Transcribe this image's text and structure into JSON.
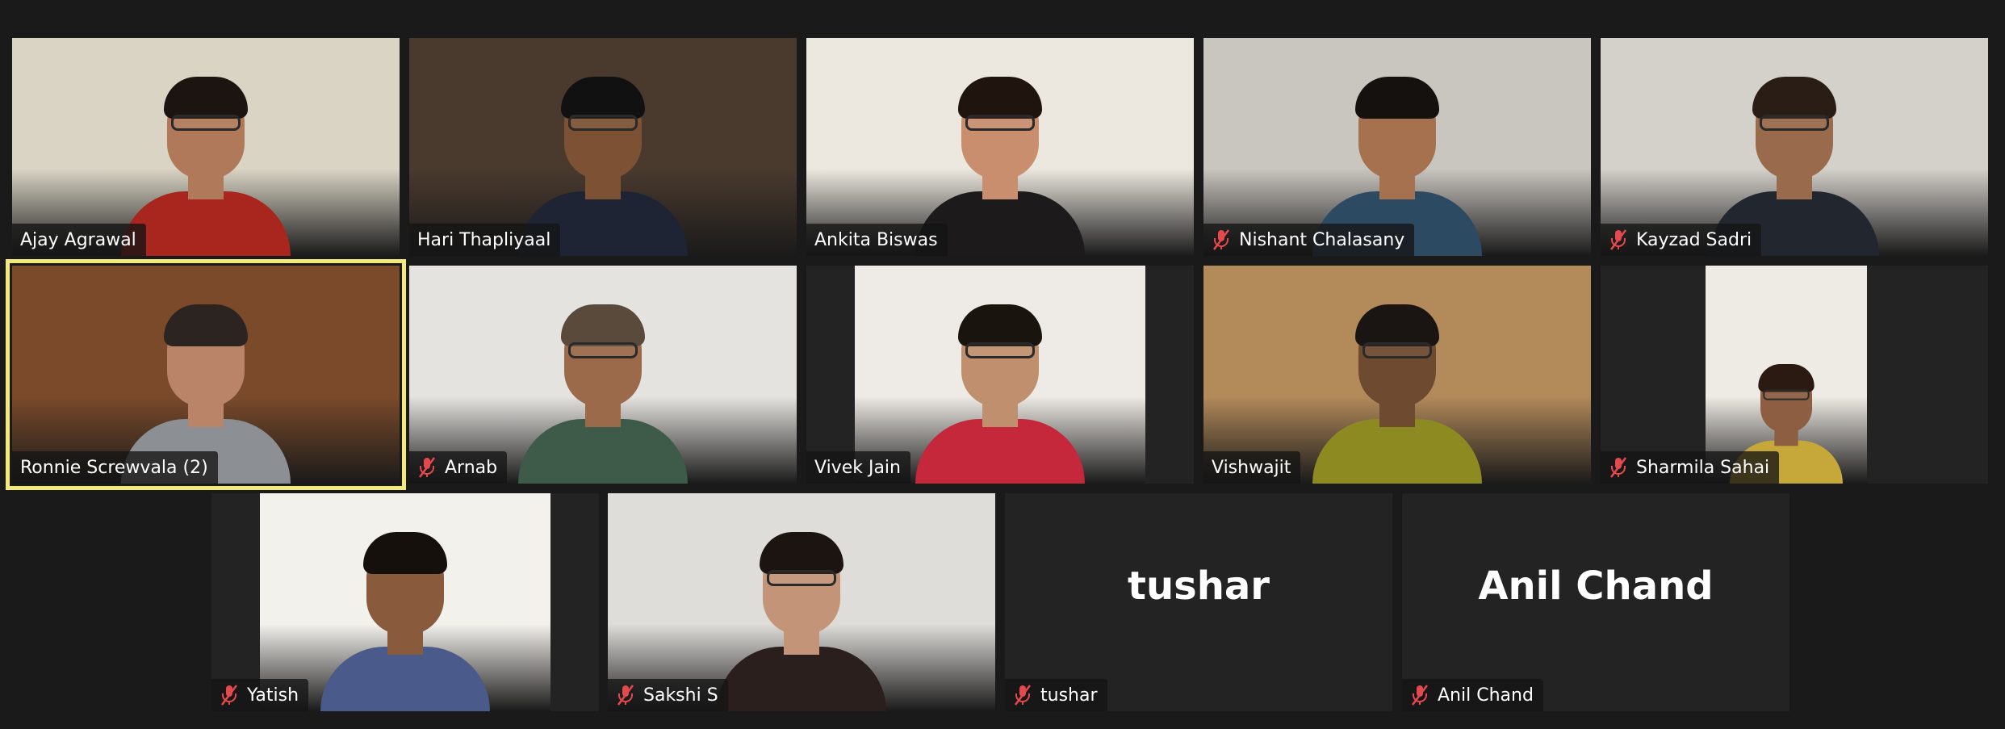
{
  "meeting": {
    "active_speaker": "Ronnie Screwvala (2)",
    "participants": [
      {
        "name": "Ajay Agrawal",
        "muted": false,
        "video": true,
        "bg": "#d9d4c4",
        "shirt": "#a8261e",
        "skin": "#b07a5a",
        "hair": "#1b1410",
        "glasses": true
      },
      {
        "name": "Hari Thapliyaal",
        "muted": false,
        "video": true,
        "bg": "#4a3a2e",
        "shirt": "#1e2433",
        "skin": "#7d5234",
        "hair": "#111111",
        "glasses": true
      },
      {
        "name": "Ankita Biswas",
        "muted": false,
        "video": true,
        "bg": "#ece8df",
        "shirt": "#1c1a1a",
        "skin": "#c98e6e",
        "hair": "#20140e",
        "glasses": true
      },
      {
        "name": "Nishant Chalasany",
        "muted": true,
        "video": true,
        "bg": "#c9c5bf",
        "shirt": "#2d4a63",
        "skin": "#a5714f",
        "hair": "#15110e",
        "glasses": false
      },
      {
        "name": "Kayzad Sadri",
        "muted": true,
        "video": true,
        "bg": "#d4d0ca",
        "shirt": "#22262e",
        "skin": "#9a6a4c",
        "hair": "#2a1d15",
        "glasses": true
      },
      {
        "name": "Ronnie Screwvala (2)",
        "muted": false,
        "video": true,
        "bg": "#7a4a2a",
        "shirt": "#8c8f93",
        "skin": "#b98467",
        "hair": "#2b2420",
        "glasses": false
      },
      {
        "name": "Arnab",
        "muted": true,
        "video": true,
        "bg": "#e5e3df",
        "shirt": "#3e5a48",
        "skin": "#9a6a4a",
        "hair": "#5a4a3c",
        "glasses": true
      },
      {
        "name": "Vivek Jain",
        "muted": false,
        "video": true,
        "bg": "#eeeae5",
        "shirt": "#c4283a",
        "skin": "#c0906e",
        "hair": "#1a140f",
        "glasses": true
      },
      {
        "name": "Vishwajit",
        "muted": false,
        "video": true,
        "bg": "#b38a5a",
        "shirt": "#8d8a22",
        "skin": "#6e4a30",
        "hair": "#1a1512",
        "glasses": true
      },
      {
        "name": "Sharmila Sahai",
        "muted": true,
        "video": true,
        "bg": "#eeeae4",
        "shirt": "#c6a83a",
        "skin": "#8d5e42",
        "hair": "#2a1a12",
        "glasses": true
      },
      {
        "name": "Yatish",
        "muted": true,
        "video": true,
        "bg": "#f3f1ec",
        "shirt": "#4a5a8a",
        "skin": "#8a5a3c",
        "hair": "#15100c",
        "glasses": false
      },
      {
        "name": "Sakshi S",
        "muted": true,
        "video": true,
        "bg": "#dfddd9",
        "shirt": "#2a1f1c",
        "skin": "#c49478",
        "hair": "#1c1411",
        "glasses": true
      },
      {
        "name": "tushar",
        "muted": true,
        "video": false,
        "display_name": "tushar"
      },
      {
        "name": "Anil Chand",
        "muted": true,
        "video": false,
        "display_name": "Anil Chand"
      }
    ]
  },
  "icons": {
    "muted": "muted-mic-icon"
  },
  "colors": {
    "background": "#1a1a1a",
    "tile": "#232323",
    "speaker_highlight": "#f2ea7b",
    "mute_red": "#e5484d"
  }
}
